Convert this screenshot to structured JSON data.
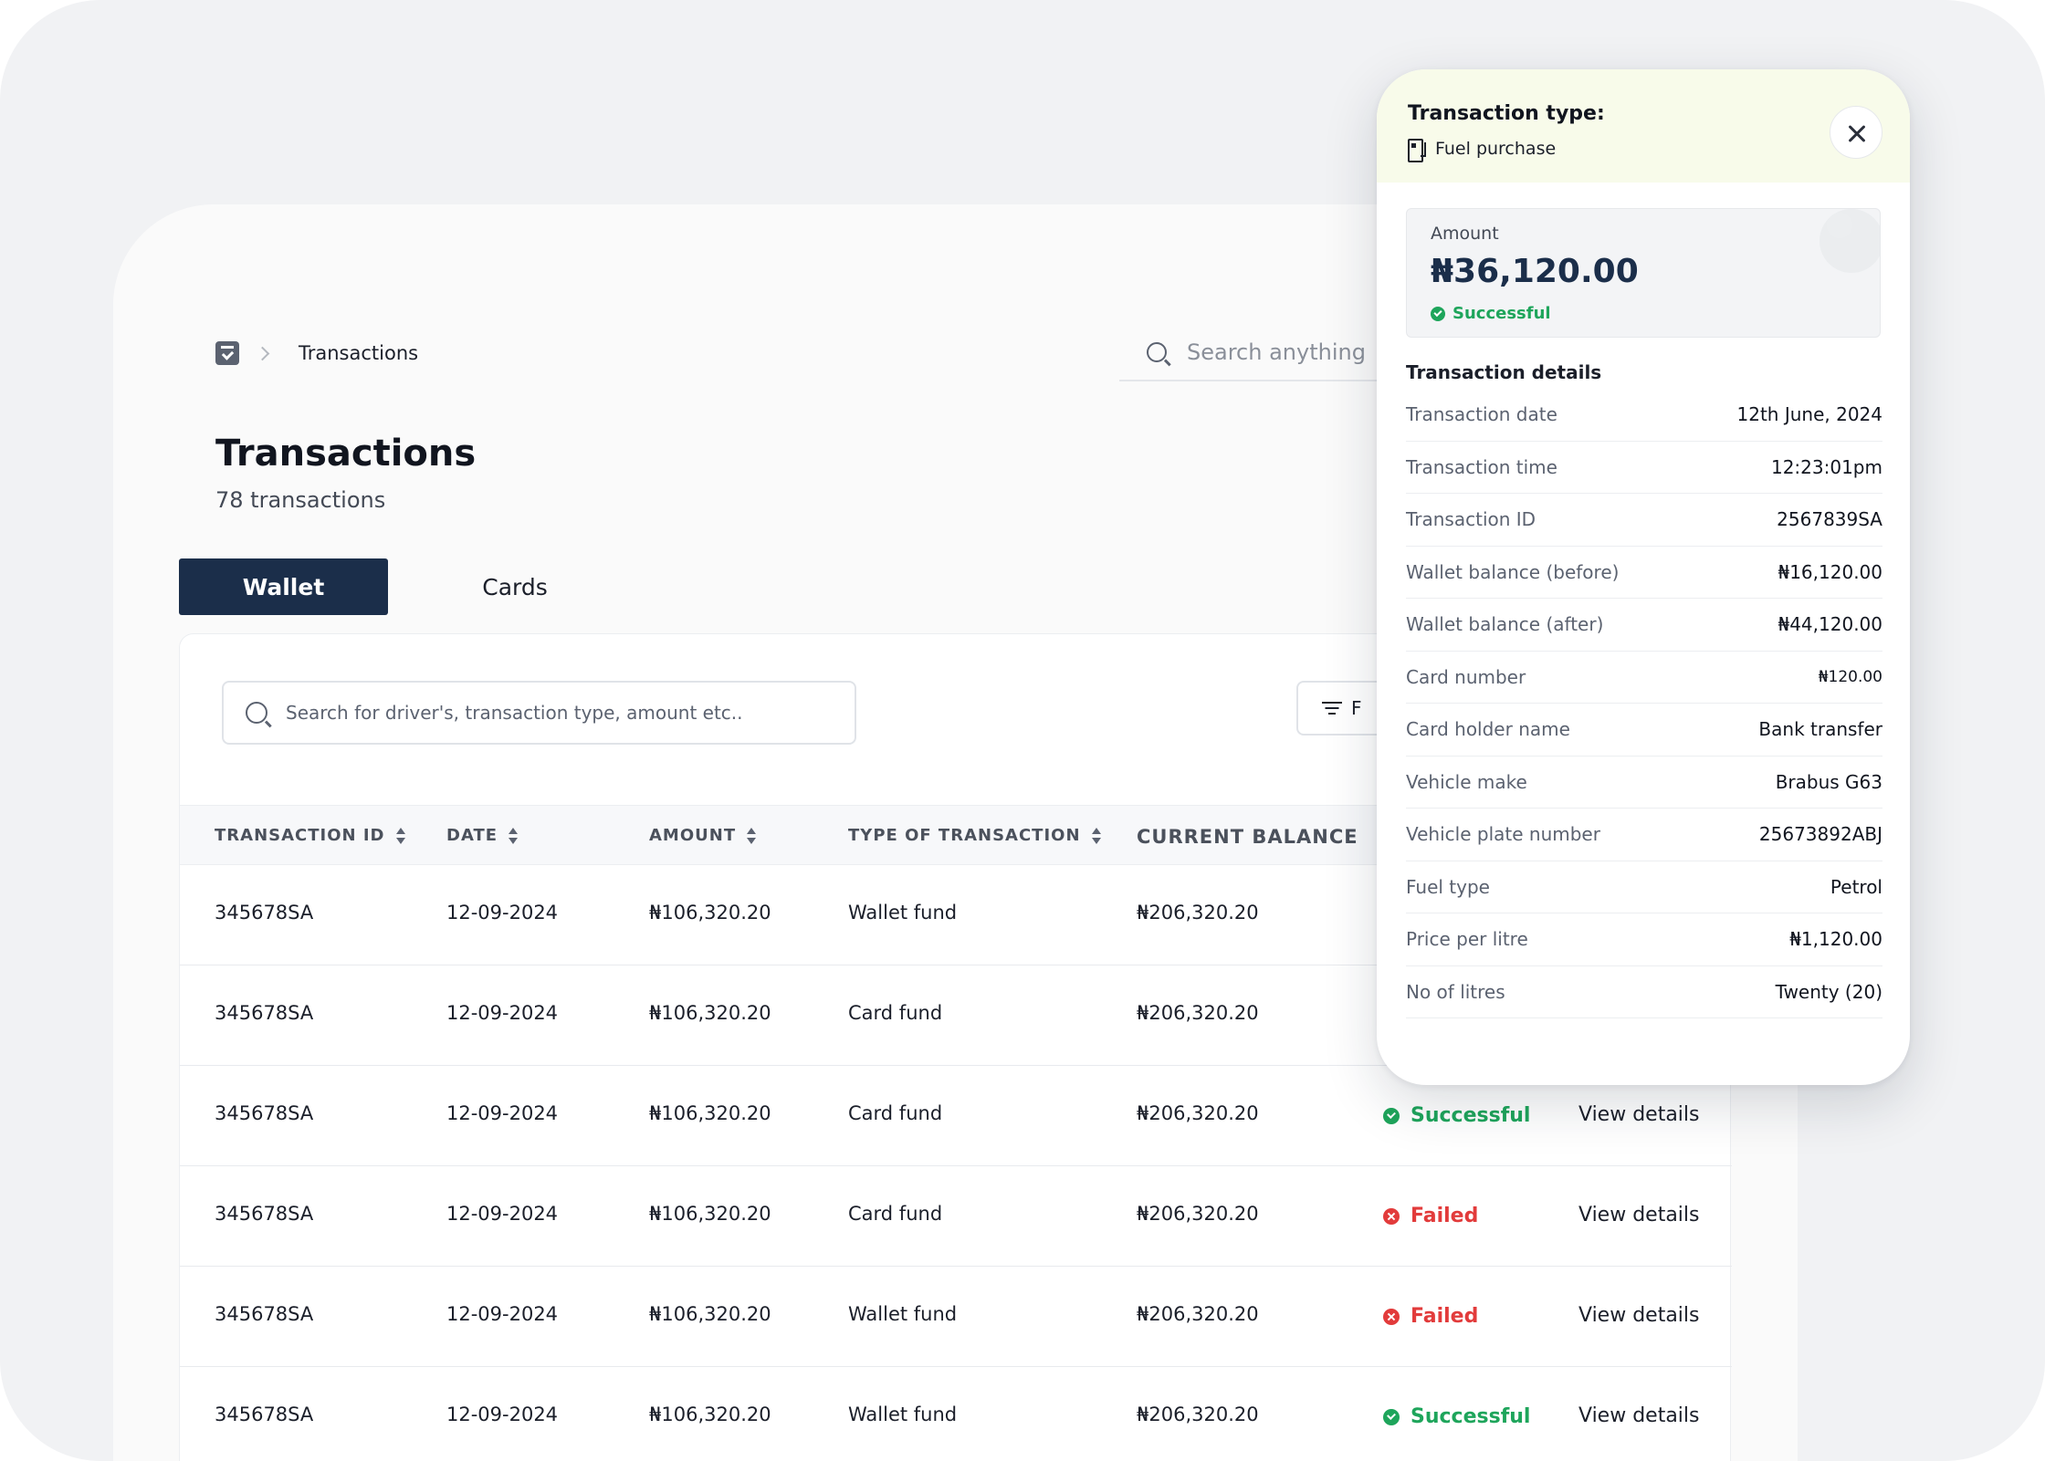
{
  "breadcrumb": {
    "current": "Transactions"
  },
  "top_search": {
    "placeholder": "Search anything"
  },
  "page": {
    "title": "Transactions",
    "subtitle": "78 transactions"
  },
  "tabs": [
    {
      "label": "Wallet",
      "active": true
    },
    {
      "label": "Cards",
      "active": false
    }
  ],
  "table": {
    "search_placeholder": "Search for driver's, transaction type, amount etc..",
    "filter_label": "F",
    "columns": [
      "TRANSACTION ID",
      "DATE",
      "AMOUNT",
      "TYPE OF TRANSACTION",
      "CURRENT BALANCE"
    ],
    "rows": [
      {
        "id": "345678SA",
        "date": "12-09-2024",
        "amount": "₦106,320.20",
        "type": "Wallet fund",
        "balance": "₦206,320.20",
        "status": "",
        "action": ""
      },
      {
        "id": "345678SA",
        "date": "12-09-2024",
        "amount": "₦106,320.20",
        "type": "Card fund",
        "balance": "₦206,320.20",
        "status": "",
        "action": ""
      },
      {
        "id": "345678SA",
        "date": "12-09-2024",
        "amount": "₦106,320.20",
        "type": "Card fund",
        "balance": "₦206,320.20",
        "status": "Successful",
        "action": "View details"
      },
      {
        "id": "345678SA",
        "date": "12-09-2024",
        "amount": "₦106,320.20",
        "type": "Card fund",
        "balance": "₦206,320.20",
        "status": "Failed",
        "action": "View details"
      },
      {
        "id": "345678SA",
        "date": "12-09-2024",
        "amount": "₦106,320.20",
        "type": "Wallet fund",
        "balance": "₦206,320.20",
        "status": "Failed",
        "action": "View details"
      },
      {
        "id": "345678SA",
        "date": "12-09-2024",
        "amount": "₦106,320.20",
        "type": "Wallet fund",
        "balance": "₦206,320.20",
        "status": "Successful",
        "action": "View details"
      }
    ]
  },
  "panel": {
    "title": "Transaction type:",
    "type": "Fuel purchase",
    "amount_label": "Amount",
    "amount": "₦36,120.00",
    "status": "Successful",
    "details_title": "Transaction details",
    "details": [
      {
        "key": "Transaction date",
        "value": "12th June, 2024"
      },
      {
        "key": "Transaction time",
        "value": "12:23:01pm"
      },
      {
        "key": "Transaction ID",
        "value": "2567839SA"
      },
      {
        "key": "Wallet balance (before)",
        "value": "₦16,120.00"
      },
      {
        "key": "Wallet balance (after)",
        "value": "₦44,120.00"
      },
      {
        "key": "Card number",
        "value": "₦120.00"
      },
      {
        "key": "Card holder name",
        "value": "Bank transfer"
      },
      {
        "key": "Vehicle make",
        "value": "Brabus G63"
      },
      {
        "key": "Vehicle plate number",
        "value": "25673892ABJ"
      },
      {
        "key": "Fuel type",
        "value": "Petrol"
      },
      {
        "key": "Price per litre",
        "value": "₦1,120.00"
      },
      {
        "key": "No of litres",
        "value": "Twenty (20)"
      }
    ]
  },
  "colors": {
    "primary": "#1b2e4a",
    "success": "#1ea55b",
    "failed": "#e23b3b",
    "panel_header": "#f8fbea"
  }
}
